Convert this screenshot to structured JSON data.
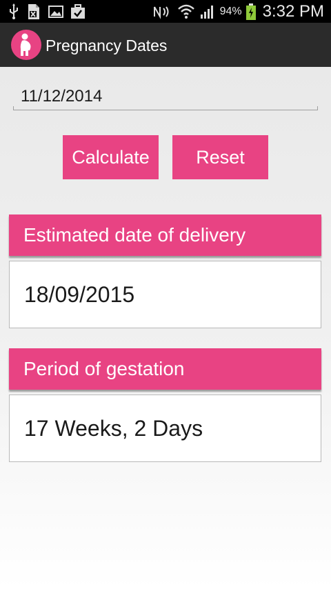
{
  "status_bar": {
    "battery_percent": "94%",
    "time": "3:32 PM",
    "left_icons": [
      "usb-icon",
      "excel-file-icon",
      "image-icon",
      "briefcase-check-icon"
    ],
    "right_icons": [
      "nfc-icon",
      "wifi-icon",
      "signal-icon",
      "battery-charging-icon"
    ]
  },
  "app": {
    "title": "Pregnancy Dates",
    "icon": "pregnant-woman-icon",
    "accent_color": "#e84383"
  },
  "form": {
    "date_value": "11/12/2014"
  },
  "buttons": {
    "calculate_label": "Calculate",
    "reset_label": "Reset"
  },
  "results": {
    "edd_label": "Estimated date of delivery",
    "edd_value": "18/09/2015",
    "gestation_label": "Period of gestation",
    "gestation_value": "17 Weeks, 2 Days"
  }
}
